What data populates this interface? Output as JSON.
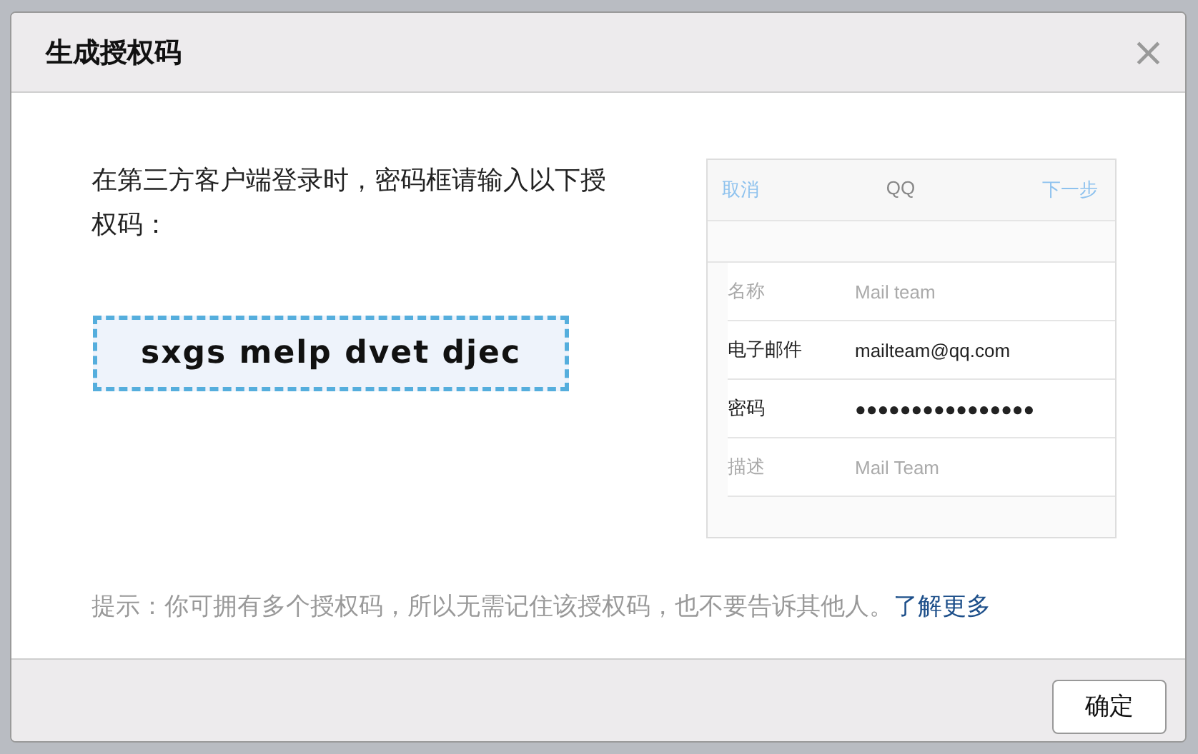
{
  "dialog": {
    "title": "生成授权码",
    "close": "×"
  },
  "instruction": "在第三方客户端登录时，密码框请输入以下授权码：",
  "code": "sxgs melp dvet djec",
  "phone_example": {
    "nav": {
      "left": "取消",
      "title": "QQ",
      "right": "下一步"
    },
    "rows": [
      {
        "label": "名称",
        "placeholder": "Mail team"
      },
      {
        "label": "电子邮件",
        "value": "mailteam@qq.com"
      },
      {
        "label": "密码",
        "value": "●●●●●●●●●●●●●●●●"
      },
      {
        "label": "描述",
        "placeholder": "Mail Team"
      }
    ]
  },
  "hint": {
    "text": "提示：你可拥有多个授权码，所以无需记住该授权码，也不要告诉其他人。",
    "link": "了解更多"
  },
  "buttons": [
    "确定"
  ]
}
